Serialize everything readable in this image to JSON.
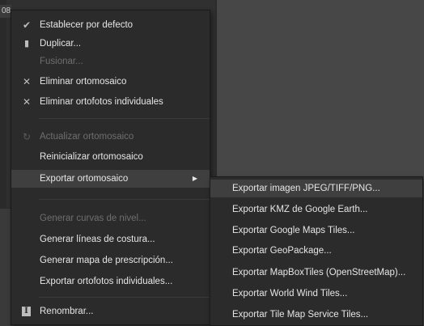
{
  "background": {
    "tab_text": "08"
  },
  "context_menu": {
    "items": [
      {
        "label": "Establecer por defecto",
        "icon": "check-icon"
      },
      {
        "label": "Duplicar...",
        "icon": "copy-icon"
      },
      {
        "label": "Fusionar...",
        "disabled": true
      },
      {
        "label": "Eliminar ortomosaico",
        "icon": "close-icon"
      },
      {
        "label": "Eliminar ortofotos individuales",
        "icon": "close-icon"
      },
      {
        "label": "Actualizar ortomosaico",
        "icon": "refresh-icon",
        "disabled": true
      },
      {
        "label": "Reinicializar ortomosaico"
      },
      {
        "label": "Exportar ortomosaico",
        "submenu": true,
        "highlighted": true
      },
      {
        "label": "Generar curvas de nivel...",
        "disabled": true
      },
      {
        "label": "Generar líneas de costura..."
      },
      {
        "label": "Generar mapa de prescripción..."
      },
      {
        "label": "Exportar ortofotos individuales..."
      },
      {
        "label": "Renombrar...",
        "icon": "rename-icon"
      }
    ]
  },
  "submenu": {
    "items": [
      {
        "label": "Exportar imagen JPEG/TIFF/PNG...",
        "highlighted": true
      },
      {
        "label": "Exportar KMZ de Google Earth..."
      },
      {
        "label": "Exportar Google Maps Tiles..."
      },
      {
        "label": "Exportar GeoPackage..."
      },
      {
        "label": "Exportar MapBoxTiles (OpenStreetMap)..."
      },
      {
        "label": "Exportar World Wind Tiles..."
      },
      {
        "label": "Exportar Tile Map Service Tiles..."
      }
    ]
  },
  "icons": {
    "check": "✔",
    "copy": "▮",
    "close": "✕",
    "refresh": "↻",
    "rename": "I",
    "submenu_arrow": "▶"
  },
  "colors": {
    "menu_bg": "#2b2b2b",
    "highlight": "#3f3f3f",
    "text": "#e6e6e6",
    "disabled_text": "#6f6f6f"
  }
}
